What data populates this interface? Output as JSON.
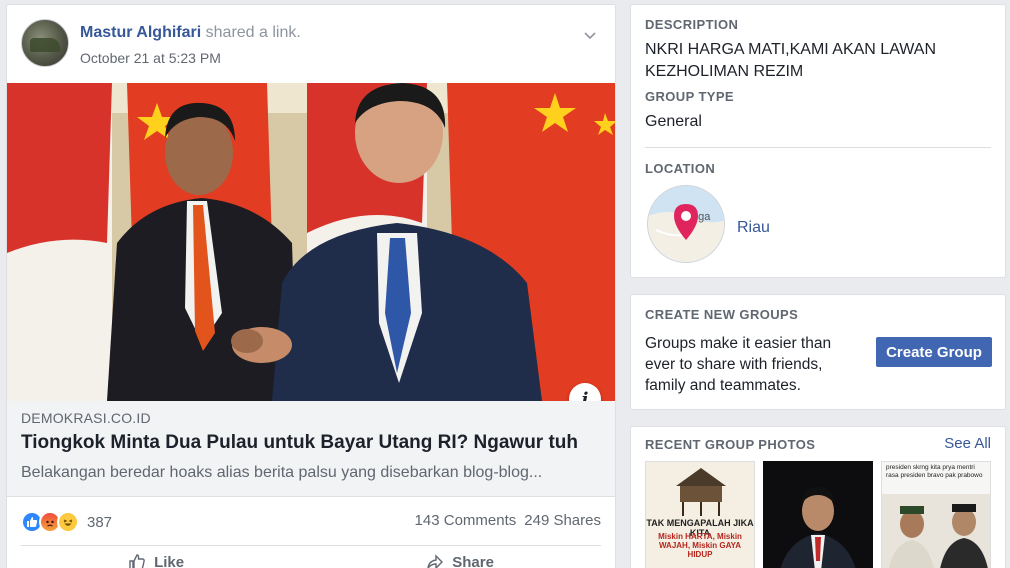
{
  "post": {
    "author": "Mastur Alghifari",
    "action": "shared a link.",
    "timestamp": "October 21 at 5:23 PM",
    "link": {
      "domain": "DEMOKRASI.CO.ID",
      "title": "Tiongkok Minta Dua Pulau untuk Bayar Utang RI? Ngawur tuh",
      "description": "Belakangan beredar hoaks alias berita palsu yang disebarkan blog-blog..."
    },
    "reaction_count": "387",
    "comments": "143 Comments",
    "shares": "249 Shares",
    "actions": {
      "like": "Like",
      "share": "Share"
    }
  },
  "about": {
    "description_label": "DESCRIPTION",
    "description_value": "NKRI HARGA MATI,KAMI AKAN LAWAN KEZHOLIMAN REZIM",
    "group_type_label": "GROUP TYPE",
    "group_type_value": "General",
    "location_label": "LOCATION",
    "location_value": "Riau",
    "map_text": "nga"
  },
  "create_groups": {
    "label": "CREATE NEW GROUPS",
    "text": "Groups make it easier than ever to share with friends, family and teammates.",
    "button": "Create Group"
  },
  "recent_photos": {
    "label": "RECENT GROUP PHOTOS",
    "see_all": "See All",
    "photo1_heading": "TAK MENGAPALAH JIKA KITA",
    "photo1_sub": "Miskin HARTA, Miskin WAJAH, Miskin GAYA HIDUP",
    "photo3_text": "presiden skrng kita prya mentri rasa presiden bravo pak prabowo"
  },
  "colors": {
    "link_blue": "#365899",
    "button_blue": "#4267b2",
    "page_bg": "#e9ebee"
  }
}
